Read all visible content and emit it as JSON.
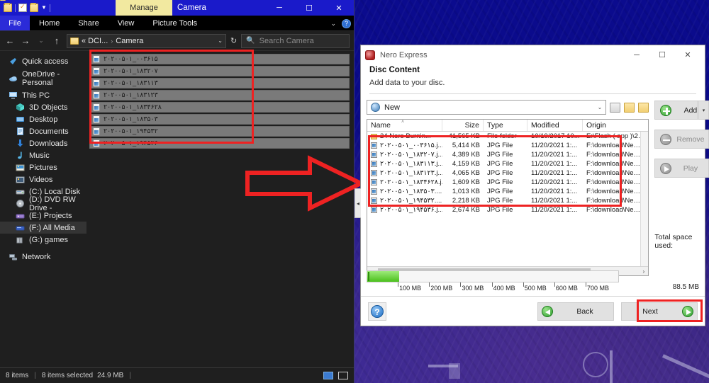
{
  "explorer": {
    "title": "Camera",
    "contextual_tab": "Manage",
    "quick_access_icons": [
      "folder-icon",
      "properties-icon",
      "new-folder-icon",
      "customize-chevron-icon"
    ],
    "window_buttons": {
      "minimize": "─",
      "maximize": "☐",
      "close": "✕"
    },
    "ribbon_tabs": [
      "File",
      "Home",
      "Share",
      "View",
      "Picture Tools"
    ],
    "ribbon_right": {
      "chevron": "⌄",
      "help": "?"
    },
    "address": {
      "back": "←",
      "forward": "→",
      "recent": "⌄",
      "up": "↑",
      "crumb_root": "« DCI...",
      "crumb_sep": "›",
      "crumb_leaf": "Camera",
      "dropdown": "⌄",
      "refresh": "↻"
    },
    "search": {
      "placeholder": "Search Camera",
      "icon": "search-icon"
    },
    "nav": [
      {
        "label": "Quick access",
        "icon": "pin-icon"
      },
      {
        "label": "OneDrive - Personal",
        "icon": "cloud-icon"
      },
      {
        "label": "This PC",
        "icon": "pc-icon"
      },
      {
        "label": "3D Objects",
        "icon": "cube-icon"
      },
      {
        "label": "Desktop",
        "icon": "desktop-icon"
      },
      {
        "label": "Documents",
        "icon": "documents-icon"
      },
      {
        "label": "Downloads",
        "icon": "download-icon"
      },
      {
        "label": "Music",
        "icon": "music-icon"
      },
      {
        "label": "Pictures",
        "icon": "pictures-icon"
      },
      {
        "label": "Videos",
        "icon": "videos-icon"
      },
      {
        "label": "(C:) Local Disk",
        "icon": "drive-icon"
      },
      {
        "label": "(D:) DVD RW Drive -",
        "icon": "disc-icon"
      },
      {
        "label": "(E:) Projects",
        "icon": "drive-icon"
      },
      {
        "label": "(F:) All Media",
        "icon": "drive-icon"
      },
      {
        "label": "(G:) games",
        "icon": "drive-icon"
      },
      {
        "label": "Network",
        "icon": "network-icon"
      }
    ],
    "files": [
      "۲۰۲۰۰۵۰۱_۰۰۳۶۱۵",
      "۲۰۲۰۰۵۰۱_۱۸۳۲۰۷",
      "۲۰۲۰۰۵۰۱_۱۸۳۱۱۳",
      "۲۰۲۰۰۵۰۱_۱۸۳۱۲۳",
      "۲۰۲۰۰۵۰۱_۱۸۳۴۶۲۸",
      "۲۰۲۰۰۵۰۱_۱۸۳۵۰۳",
      "۲۰۲۰۰۵۰۱_۱۹۴۵۳۲",
      "۲۰۲۰۰۵۰۱_۱۹۴۵۳۶"
    ],
    "status": {
      "item_count": "8 items",
      "selection": "8 items selected",
      "selection_size": "24.9 MB",
      "view_icons": [
        "details-view-icon",
        "large-icons-view-icon"
      ]
    }
  },
  "annotation": {
    "arrow": "red-right-arrow",
    "color": "#ee2222"
  },
  "nero": {
    "app_title": "Nero Express",
    "window_buttons": {
      "minimize": "─",
      "maximize": "☐",
      "close": "✕"
    },
    "page_title": "Disc Content",
    "page_subtitle": "Add data to your disc.",
    "compilation": {
      "value": "New",
      "chevron": "⌄"
    },
    "toolbar_icons": [
      "new-disc-icon",
      "open-folder-icon",
      "copy-icon"
    ],
    "columns": [
      "Name",
      "Size",
      "Type",
      "Modified",
      "Origin"
    ],
    "sort_indicator": "˄",
    "rows": [
      {
        "name": "24 Nero Burnin...",
        "size": "41,565 KB",
        "type": "File folder",
        "modified": "10/19/2017 10...",
        "origin": "E:\\Flash ( app )\\2…",
        "icon": "folder-icon"
      },
      {
        "name": "۲۰۲۰۰۵۰۱_۰۰۳۶۱۵.j...",
        "size": "5,414 KB",
        "type": "JPG File",
        "modified": "11/20/2021 1:...",
        "origin": "F:\\download\\Ne…",
        "icon": "jpg-icon"
      },
      {
        "name": "۲۰۲۰۰۵۰۱_۱۸۳۲۰۷.j...",
        "size": "4,389 KB",
        "type": "JPG File",
        "modified": "11/20/2021 1:...",
        "origin": "F:\\download\\Ne…",
        "icon": "jpg-icon"
      },
      {
        "name": "۲۰۲۰۰۵۰۱_۱۸۳۱۱۳.j...",
        "size": "4,159 KB",
        "type": "JPG File",
        "modified": "11/20/2021 1:...",
        "origin": "F:\\download\\Ne…",
        "icon": "jpg-icon"
      },
      {
        "name": "۲۰۲۰۰۵۰۱_۱۸۳۱۲۳.j...",
        "size": "4,065 KB",
        "type": "JPG File",
        "modified": "11/20/2021 1:...",
        "origin": "F:\\download\\Ne…",
        "icon": "jpg-icon"
      },
      {
        "name": "۲۰۲۰۰۵۰۱_۱۸۳۴۶۲۸.j...",
        "size": "1,609 KB",
        "type": "JPG File",
        "modified": "11/20/2021 1:...",
        "origin": "F:\\download\\Ne…",
        "icon": "jpg-icon"
      },
      {
        "name": "۲۰۲۰۰۵۰۱_۱۸۳۵۰۳....",
        "size": "1,013 KB",
        "type": "JPG File",
        "modified": "11/20/2021 1:...",
        "origin": "F:\\download\\Ne…",
        "icon": "jpg-icon"
      },
      {
        "name": "۲۰۲۰۰۵۰۱_۱۹۴۵۳۲....",
        "size": "2,218 KB",
        "type": "JPG File",
        "modified": "11/20/2021 1:...",
        "origin": "F:\\download\\Ne…",
        "icon": "jpg-icon"
      },
      {
        "name": "۲۰۲۰۰۵۰۱_۱۹۴۵۳۶.j...",
        "size": "2,674 KB",
        "type": "JPG File",
        "modified": "11/20/2021 1:...",
        "origin": "F:\\download\\Ne…",
        "icon": "jpg-icon"
      }
    ],
    "actions": {
      "add": "Add",
      "add_dropdown": "▾",
      "remove": "Remove",
      "play": "Play"
    },
    "space": {
      "label": "Total space used:",
      "used": "88.5 MB",
      "ticks": [
        "100 MB",
        "200 MB",
        "300 MB",
        "400 MB",
        "500 MB",
        "600 MB",
        "700 MB"
      ],
      "fill_percent": 12.6
    },
    "scroll": {
      "left": "‹",
      "right": "›"
    },
    "footer": {
      "help": "?",
      "back": "Back",
      "next": "Next"
    },
    "handle": "◂"
  }
}
